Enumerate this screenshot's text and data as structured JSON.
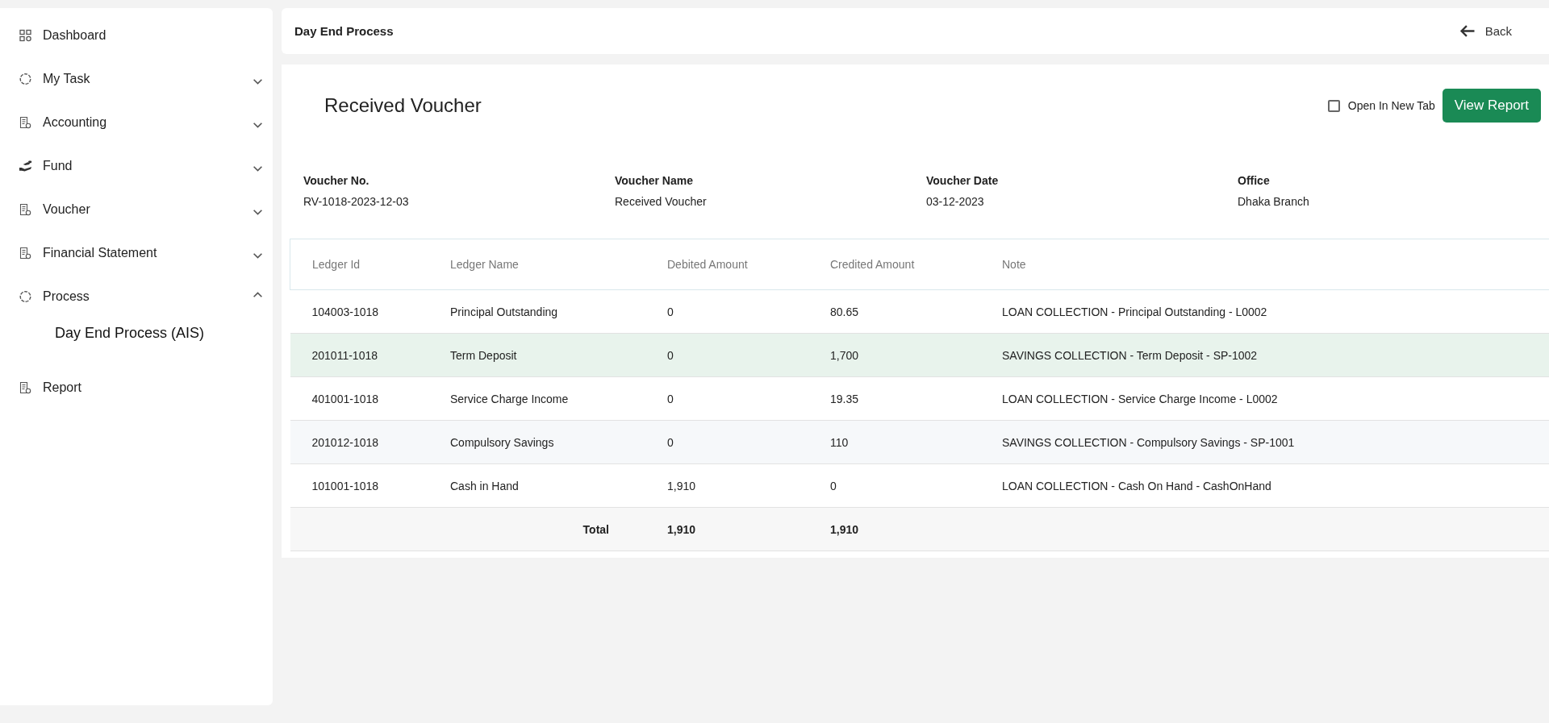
{
  "sidebar": {
    "items": [
      {
        "label": "Dashboard"
      },
      {
        "label": "My Task",
        "expanded": false
      },
      {
        "label": "Accounting",
        "expanded": false
      },
      {
        "label": "Fund",
        "expanded": false
      },
      {
        "label": "Voucher",
        "expanded": false
      },
      {
        "label": "Financial Statement",
        "expanded": false
      },
      {
        "label": "Process",
        "expanded": true,
        "children": [
          {
            "label": "Day End Process (AIS)"
          }
        ]
      },
      {
        "label": "Report"
      }
    ]
  },
  "header": {
    "title": "Day End Process",
    "back": "Back"
  },
  "report": {
    "title": "Received Voucher",
    "open_in_new_tab": {
      "label": "Open In New Tab",
      "checked": false
    },
    "button": "View Report"
  },
  "details": [
    {
      "label": "Voucher No.",
      "value": "RV-1018-2023-12-03"
    },
    {
      "label": "Voucher Name",
      "value": "Received Voucher"
    },
    {
      "label": "Voucher Date",
      "value": "03-12-2023"
    },
    {
      "label": "Office",
      "value": "Dhaka Branch"
    }
  ],
  "table": {
    "columns": [
      "Ledger Id",
      "Ledger Name",
      "Debited Amount",
      "Credited Amount",
      "Note"
    ],
    "rows": [
      {
        "cells": [
          "104003-1018",
          "Principal Outstanding",
          "0",
          "80.65",
          "LOAN COLLECTION - Principal Outstanding - L0002"
        ],
        "selected": false
      },
      {
        "cells": [
          "201011-1018",
          "Term Deposit",
          "0",
          "1,700",
          "SAVINGS COLLECTION - Term Deposit - SP-1002"
        ],
        "selected": true
      },
      {
        "cells": [
          "401001-1018",
          "Service Charge Income",
          "0",
          "19.35",
          "LOAN COLLECTION - Service Charge Income - L0002"
        ],
        "selected": false
      },
      {
        "cells": [
          "201012-1018",
          "Compulsory Savings",
          "0",
          "110",
          "SAVINGS COLLECTION - Compulsory Savings - SP-1001"
        ],
        "selected": false
      },
      {
        "cells": [
          "101001-1018",
          "Cash in Hand",
          "1,910",
          "0",
          "LOAN COLLECTION - Cash On Hand - CashOnHand"
        ],
        "selected": false
      }
    ],
    "total": {
      "label": "Total",
      "debited": "1,910",
      "credited": "1,910"
    }
  }
}
